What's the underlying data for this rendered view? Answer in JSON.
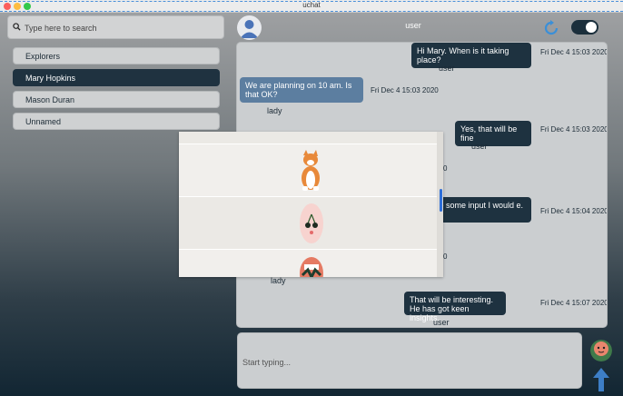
{
  "window": {
    "title": "uchat"
  },
  "colors": {
    "accent": "#1f3240",
    "blue_bubble": "#5c7ea0",
    "refresh": "#3a8fd8",
    "send": "#3d7ec6"
  },
  "search": {
    "placeholder": "Type here to search",
    "icon": "search-icon"
  },
  "rooms": [
    {
      "label": "Explorers",
      "active": false
    },
    {
      "label": "Mary Hopkins",
      "active": true
    },
    {
      "label": "Mason Duran",
      "active": false
    },
    {
      "label": "Unnamed",
      "active": false
    }
  ],
  "header": {
    "user": "user",
    "avatar_icon": "user-avatar-icon",
    "refresh_icon": "refresh-icon",
    "toggle_icon": "toggle-switch-icon",
    "toggle_on": true
  },
  "messages": [
    {
      "text": "Hi Mary. When is it taking place?",
      "time": "Fri Dec 4 15:03 2020",
      "sender": "user"
    },
    {
      "text": "We are planning on 10 am. Is that OK?",
      "time": "Fri Dec 4 15:03 2020",
      "sender": "lady"
    },
    {
      "text": "Yes, that will be fine",
      "time": "Fri Dec 4 15:03 2020",
      "sender": "user"
    },
    {
      "text": "ve some input I would e.",
      "time": "Fri Dec 4 15:04 2020",
      "sender": ""
    },
    {
      "text": "That will be interesting. He has got keen insights.",
      "time": "Fri Dec 4 15:07 2020",
      "sender": "user"
    }
  ],
  "hidden_partial": {
    "time_a": "0",
    "time_b": "0",
    "sender_b": "lady"
  },
  "sticker_picker": {
    "stickers": [
      "corgi-sticker",
      "cherries-sticker",
      "creature-sticker"
    ]
  },
  "composer": {
    "placeholder": "Start typing...",
    "sticker_icon": "sticker-face-icon",
    "send_icon": "send-arrow-icon"
  }
}
